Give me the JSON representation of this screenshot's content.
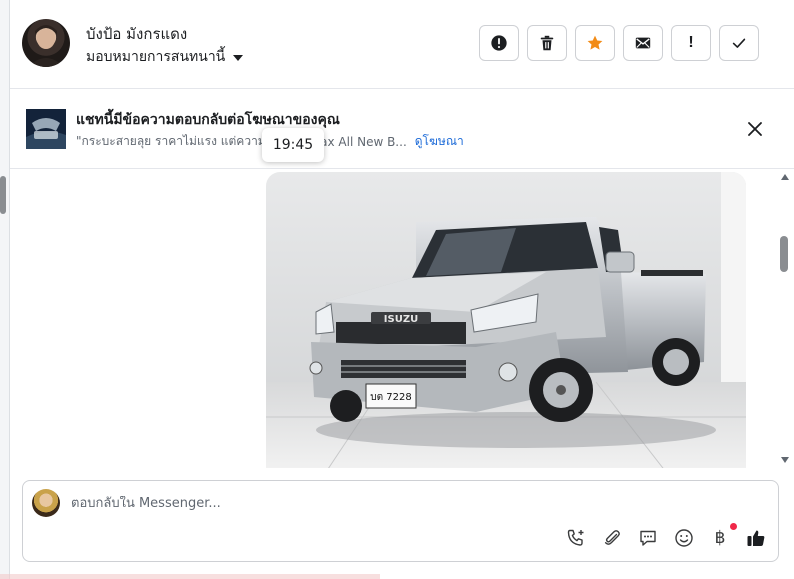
{
  "header": {
    "user_name": "บังป้อ มังกรแดง",
    "assign_label": "มอบหมายการสนทนานี้",
    "actions": [
      {
        "name": "report-button",
        "icon": "alert-circle-icon"
      },
      {
        "name": "delete-button",
        "icon": "trash-icon"
      },
      {
        "name": "star-button",
        "icon": "star-icon"
      },
      {
        "name": "mail-button",
        "icon": "envelope-icon"
      },
      {
        "name": "important-button",
        "label": "!"
      },
      {
        "name": "done-button",
        "icon": "check-icon"
      }
    ]
  },
  "ad": {
    "title": "แชทนี้มีข้อความตอบกลับต่อโฆษณาของคุณ",
    "subtitle": "\"กระบะสายลุย ราคาไม่แรง แต่ความเท่",
    "ad_name": "D-Max All New B...",
    "link_label": "ดูโฆษณา",
    "timestamp": "19:45"
  },
  "composer": {
    "placeholder": "ตอบกลับใน Messenger...",
    "currency_symbol": "฿"
  },
  "colors": {
    "star": "#f28b16",
    "link": "#1d6bd8",
    "like": "#1c1e21",
    "notification_dot": "#f02849"
  }
}
